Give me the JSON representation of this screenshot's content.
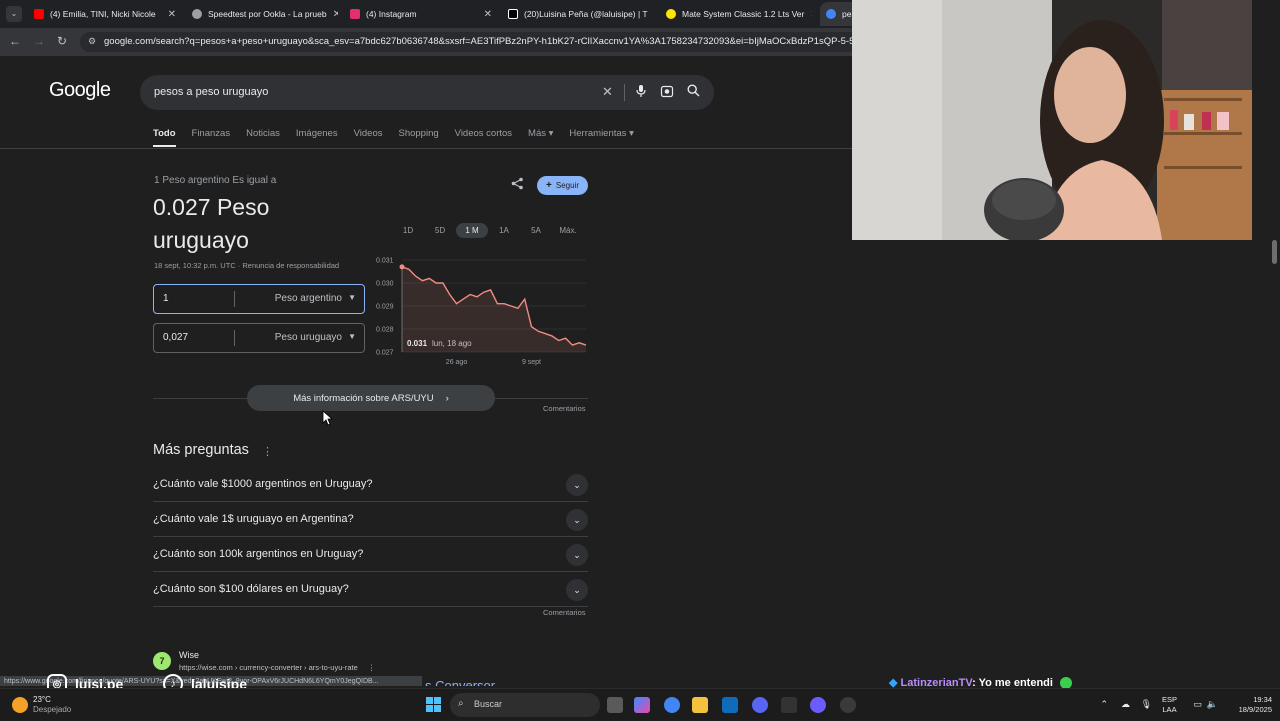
{
  "browser": {
    "tabs": [
      {
        "title": "(4) Emilia, TINI, Nicki Nicole",
        "color": "#ff0000"
      },
      {
        "title": "Speedtest por Ookla - La prueb",
        "color": "#9aa0a6"
      },
      {
        "title": "(4) Instagram",
        "color": "#e1306c"
      },
      {
        "title": "(20)Luisina Peña (@laluisipe) | T",
        "color": "#ffffff"
      },
      {
        "title": "Mate System Classic 1.2 Lts Ver",
        "color": "#ffe600"
      },
      {
        "title": "pes",
        "color": "#4285f4"
      }
    ],
    "url": "google.com/search?q=pesos+a+peso+uruguayo&sca_esv=a7bdc627b0636748&sxsrf=AE3TifPBz2nPY-h1bK27-rClIXaccnv1YA%3A1758234732093&ei=bIjMaOCxBdzP1sQP-5-52QM8"
  },
  "google": {
    "logo": "Google",
    "query": "pesos a peso uruguayo",
    "tabs": [
      "Todo",
      "Finanzas",
      "Noticias",
      "Imágenes",
      "Videos",
      "Shopping",
      "Videos cortos",
      "Más ▾",
      "Herramientas ▾"
    ]
  },
  "converter": {
    "equals_label": "1 Peso argentino Es igual a",
    "result": "0.027 Peso uruguayo",
    "date_line": "18 sept, 10:32 p.m. UTC · Renuncia de responsabilidad",
    "follow_label": "Seguir",
    "input1_value": "1",
    "input1_currency": "Peso argentino",
    "input2_value": "0,027",
    "input2_currency": "Peso uruguayo",
    "ranges": [
      "1D",
      "5D",
      "1 M",
      "1A",
      "5A",
      "Máx."
    ],
    "selected_range": "1 M",
    "more_info": "Más información sobre ARS/UYU",
    "comments": "Comentarios"
  },
  "chart_data": {
    "type": "line",
    "yticks": [
      "0.031",
      "0.030",
      "0.029",
      "0.028",
      "0.027"
    ],
    "xticks": [
      "26 ago",
      "9 sept"
    ],
    "ylim": [
      0.027,
      0.031
    ],
    "tooltip_value": "0.031",
    "tooltip_date": "lun, 18 ago",
    "line_color": "#f28b82",
    "y": [
      0.0307,
      0.0306,
      0.0303,
      0.0301,
      0.0302,
      0.03,
      0.03,
      0.0295,
      0.0291,
      0.0293,
      0.0295,
      0.0294,
      0.0296,
      0.0297,
      0.0291,
      0.0291,
      0.029,
      0.0289,
      0.0293,
      0.0281,
      0.0279,
      0.0278,
      0.0277,
      0.0275,
      0.0276,
      0.0273,
      0.0274,
      0.0273
    ]
  },
  "people_also_ask": {
    "title": "Más preguntas",
    "questions": [
      "¿Cuánto vale $1000 argentinos en Uruguay?",
      "¿Cuánto vale 1$ uruguayo en Argentina?",
      "¿Cuánto son 100k argentinos en Uruguay?",
      "¿Cuánto son $100 dólares en Uruguay?"
    ],
    "comments": "Comentarios"
  },
  "result": {
    "site": "Wise",
    "url": "https://wise.com › currency-converter › ars-to-uyu-rate",
    "title_partial": "s Conversor ..."
  },
  "status_url": "https://www.google.com/finance/quote/ARS-UYU?sa=X&ved=2ahUKEwj2_9yor-OPAxV6rJUCHdN6L6YQmY0JegQIDB...",
  "overlay": {
    "instagram": "luisi.pe",
    "tiktok": "laluisipe",
    "chat_user": "LatinzerianTV",
    "chat_text": ": Yo me entendi"
  },
  "taskbar": {
    "temp": "23°C",
    "condition": "Despejado",
    "search": "Buscar",
    "lang1": "ESP",
    "lang2": "LAA",
    "time": "19:34",
    "date": "18/9/2025"
  }
}
